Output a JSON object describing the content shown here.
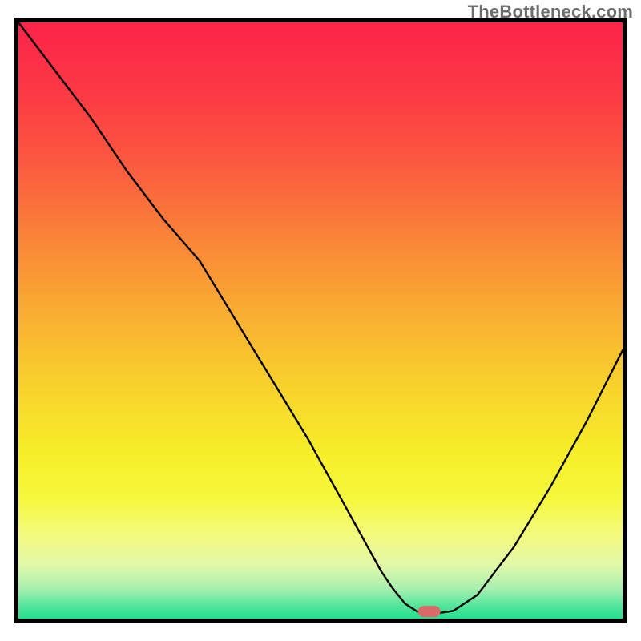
{
  "watermark": "TheBottleneck.com",
  "chart_data": {
    "type": "line",
    "title": "",
    "xlabel": "",
    "ylabel": "",
    "xlim": [
      0,
      100
    ],
    "ylim": [
      0,
      100
    ],
    "grid": false,
    "legend": false,
    "annotations": [
      {
        "kind": "marker",
        "shape": "pill",
        "x": 68,
        "y": 1.2,
        "color": "#d86a6a"
      }
    ],
    "background_gradient": {
      "type": "vertical",
      "stops": [
        {
          "offset": 0.0,
          "color": "#fd2448"
        },
        {
          "offset": 0.12,
          "color": "#fc3944"
        },
        {
          "offset": 0.24,
          "color": "#fb5b3f"
        },
        {
          "offset": 0.36,
          "color": "#fa8338"
        },
        {
          "offset": 0.48,
          "color": "#f9ab32"
        },
        {
          "offset": 0.6,
          "color": "#f8cf2c"
        },
        {
          "offset": 0.72,
          "color": "#f6ee28"
        },
        {
          "offset": 0.8,
          "color": "#f5f83c"
        },
        {
          "offset": 0.86,
          "color": "#f4fa7e"
        },
        {
          "offset": 0.91,
          "color": "#e2f8a8"
        },
        {
          "offset": 0.95,
          "color": "#a7efb0"
        },
        {
          "offset": 0.98,
          "color": "#4fe59a"
        },
        {
          "offset": 1.0,
          "color": "#1fe18e"
        }
      ]
    },
    "series": [
      {
        "name": "bottleneck-curve",
        "color": "#000000",
        "stroke_width": 2.4,
        "x": [
          0,
          6,
          12,
          18,
          24,
          30,
          36,
          42,
          48,
          54,
          60,
          62,
          64,
          66,
          68,
          70,
          72,
          76,
          82,
          88,
          94,
          100
        ],
        "y": [
          100,
          92,
          84,
          75,
          67,
          60,
          50,
          40,
          30,
          19,
          8,
          5,
          2.5,
          1.2,
          0.9,
          1.0,
          1.3,
          4,
          12,
          22,
          33,
          45
        ]
      }
    ]
  }
}
